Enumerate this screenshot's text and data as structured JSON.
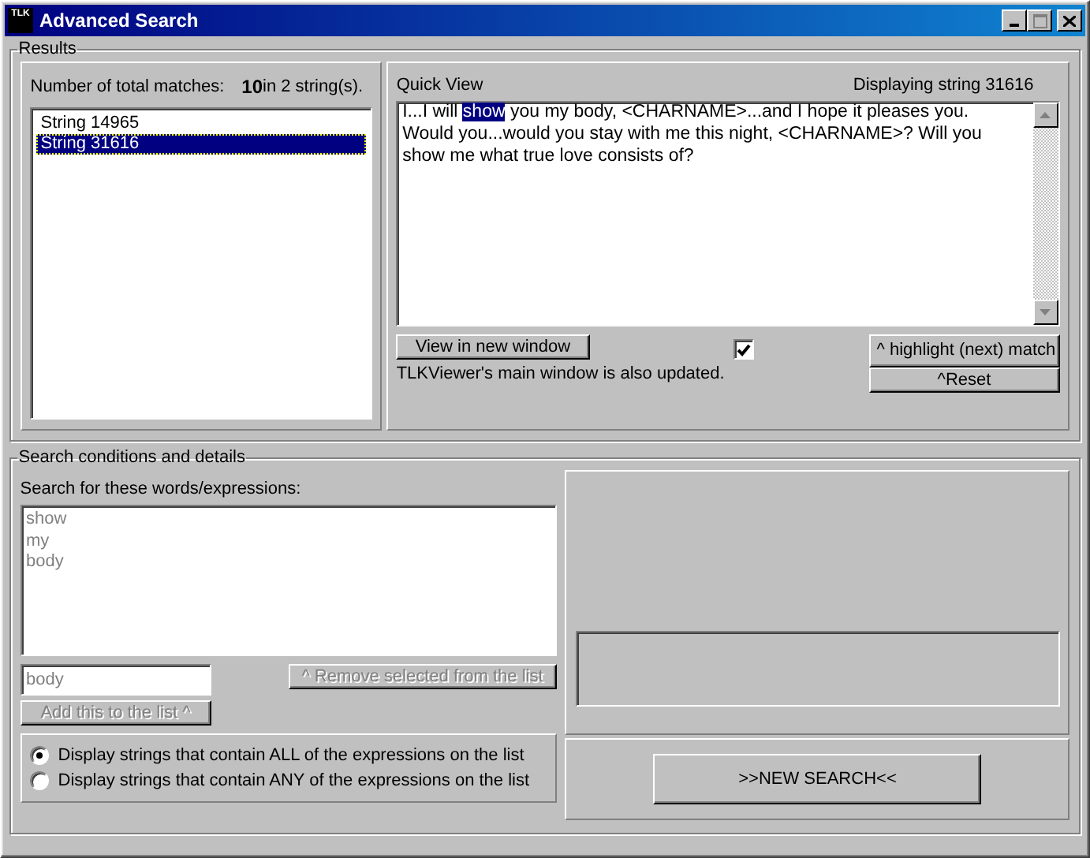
{
  "window": {
    "title": "Advanced Search",
    "app_icon_text": "TLK"
  },
  "results": {
    "legend": "Results",
    "matches_label": "Number of total matches:",
    "matches_count": "10",
    "strings_count": "in 2 string(s).",
    "strings": [
      {
        "label": "String 14965",
        "selected": false
      },
      {
        "label": "String 31616",
        "selected": true
      }
    ]
  },
  "quick_view": {
    "label": "Quick View",
    "displaying": "Displaying string 31616",
    "text_before": "I...I will ",
    "text_highlight": "show",
    "text_after": " you my body, <CHARNAME>...and I hope it pleases you.  Would you...would you stay with me this night, <CHARNAME>?  Will you show me what true love consists of?",
    "view_button": "View in new window",
    "checked": true,
    "note": "TLKViewer's main window is also updated.",
    "highlight_button": "^ highlight (next) match",
    "reset_button": "^Reset"
  },
  "search": {
    "legend": "Search conditions and details",
    "words_label": "Search for these words/expressions:",
    "words_disabled": true,
    "words": [
      "show",
      "my",
      "body"
    ],
    "input_value": "body",
    "input_disabled": true,
    "remove_button": {
      "label": "^ Remove selected from the list",
      "disabled": true
    },
    "add_button": {
      "label": "Add this to the list ^",
      "disabled": true
    },
    "modes": [
      {
        "label": "Display strings that contain ALL of the expressions on the list",
        "selected": true
      },
      {
        "label": "Display strings that contain ANY of the expressions on the list",
        "selected": false
      }
    ],
    "new_search_button": ">>NEW SEARCH<<"
  }
}
